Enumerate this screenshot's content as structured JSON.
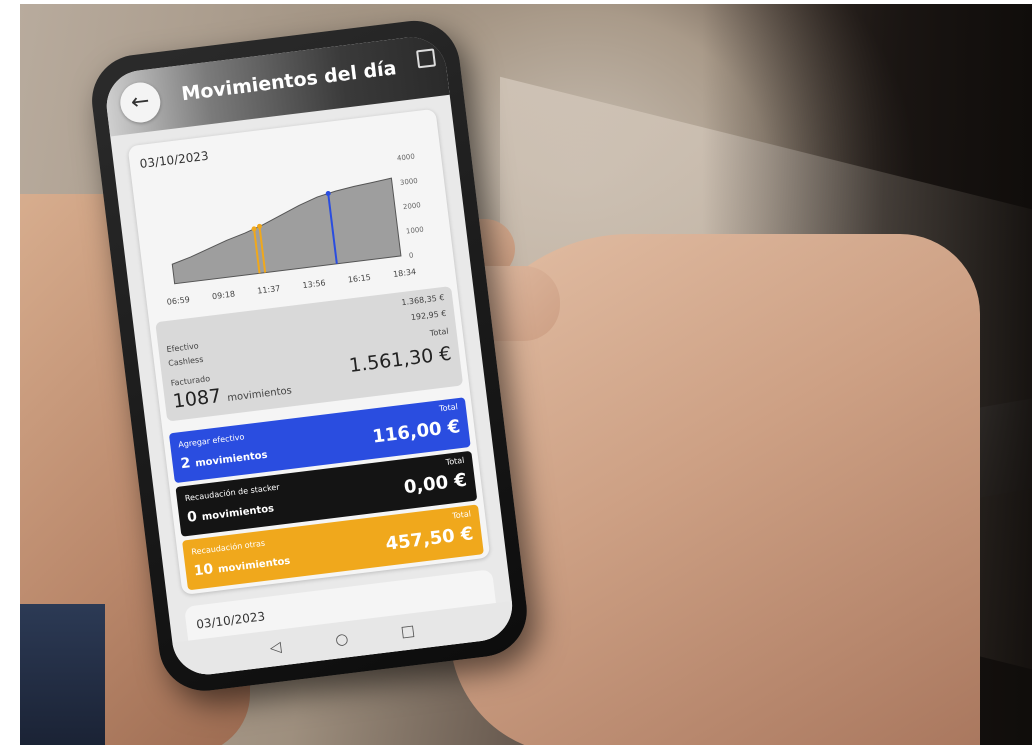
{
  "header": {
    "title": "Movimientos del día"
  },
  "card": {
    "date": "03/10/2023",
    "chart_data": {
      "type": "area",
      "x_ticks": [
        "06:59",
        "09:18",
        "11:37",
        "13:56",
        "16:15",
        "18:34"
      ],
      "y_ticks": [
        "4000",
        "3000",
        "2000",
        "1000",
        "0"
      ],
      "ylim": [
        0,
        4000
      ],
      "series": [
        {
          "values": [
            800,
            1000,
            1250,
            1500,
            1700,
            1950,
            2250,
            2550,
            2800,
            2950,
            3050,
            3120,
            3200
          ]
        }
      ],
      "colors": {
        "area": "#9e9e9e",
        "yellow_marker": "#f0a81c",
        "blue_marker": "#2a4de0"
      }
    },
    "summary": {
      "efectivo_label": "Efectivo",
      "efectivo_value": "1.368,35 €",
      "cashless_label": "Cashless",
      "cashless_value": "192,95 €",
      "facturado_label": "Facturado",
      "total_label": "Total",
      "count": "1087",
      "count_unit": "movimientos",
      "total": "1.561,30 €"
    },
    "agregar": {
      "label": "Agregar efectivo",
      "count": "2",
      "unit": "movimientos",
      "total_label": "Total",
      "total": "116,00 €",
      "color": "#2a4de0"
    },
    "stacker": {
      "label": "Recaudación de stacker",
      "count": "0",
      "unit": "movimientos",
      "total_label": "Total",
      "total": "0,00 €",
      "color": "#141414"
    },
    "otras": {
      "label": "Recaudación otras",
      "count": "10",
      "unit": "movimientos",
      "total_label": "Total",
      "total": "457,50 €",
      "color": "#f0a81c"
    }
  },
  "card2": {
    "date": "03/10/2023"
  },
  "navbar": {
    "back": "◁",
    "home": "○",
    "recent": "□"
  }
}
